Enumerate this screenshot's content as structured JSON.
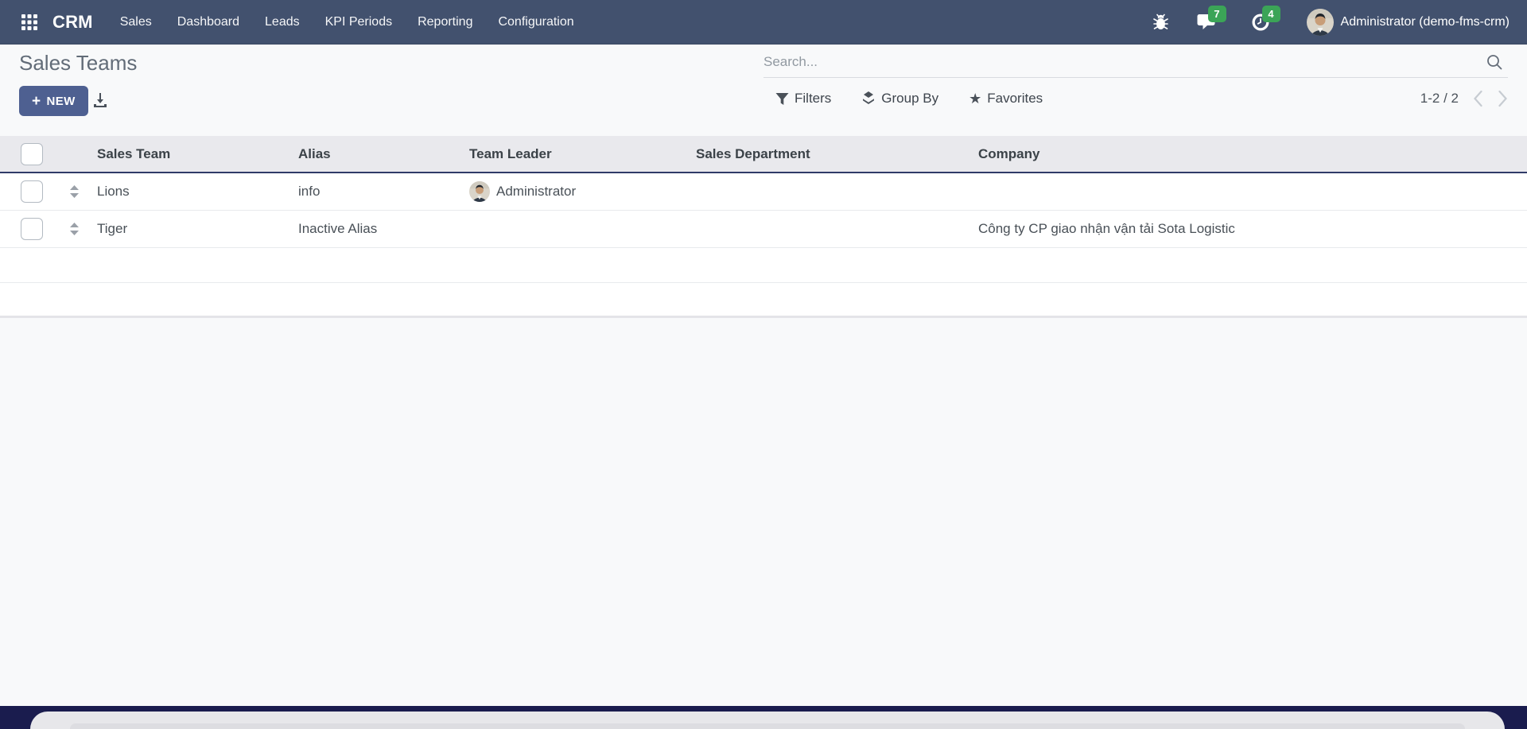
{
  "navbar": {
    "brand": "CRM",
    "menu": [
      {
        "label": "Sales"
      },
      {
        "label": "Dashboard"
      },
      {
        "label": "Leads"
      },
      {
        "label": "KPI Periods"
      },
      {
        "label": "Reporting"
      },
      {
        "label": "Configuration"
      }
    ],
    "message_badge": "7",
    "activity_badge": "4",
    "user": "Administrator (demo-fms-crm)"
  },
  "control_panel": {
    "title": "Sales Teams",
    "new_button": "NEW",
    "plus_glyph": "+",
    "search_placeholder": "Search...",
    "filters_label": "Filters",
    "group_by_label": "Group By",
    "favorites_label": "Favorites",
    "star_glyph": "★",
    "pager_text": "1-2 / 2"
  },
  "table": {
    "columns": [
      "Sales Team",
      "Alias",
      "Team Leader",
      "Sales Department",
      "Company"
    ],
    "rows": [
      {
        "sales_team": "Lions",
        "alias": "info",
        "team_leader": "Administrator",
        "sales_department": "",
        "company": ""
      },
      {
        "sales_team": "Tiger",
        "alias": "Inactive Alias",
        "team_leader": "",
        "sales_department": "",
        "company": "Công ty CP giao nhận vận tải Sota Logistic"
      }
    ]
  },
  "colors": {
    "navbar_bg": "#42516e",
    "badge_green": "#3ba457",
    "primary_button": "#4e6091",
    "header_row_bg": "#e9e9ed",
    "header_border": "#2f3a68",
    "page_bg": "#f8f9fa"
  }
}
